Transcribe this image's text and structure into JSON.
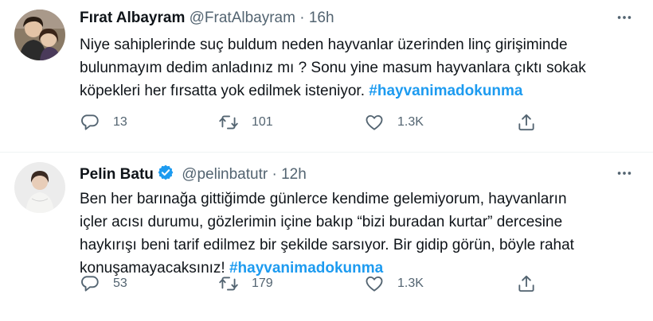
{
  "tweets": [
    {
      "name": "Fırat Albayram",
      "handle": "@FratAlbayram",
      "separator": "·",
      "time": "16h",
      "verified": false,
      "text_lines": [
        "Niye sahiplerinde suç buldum neden hayvanlar üzerinden  linç girişiminde",
        "bulunmayım dedim anladınız mı ?  Sonu yine masum hayvanlara çıktı sokak",
        "köpekleri her fırsatta yok edilmek isteniyor. "
      ],
      "hashtag": "#hayvanimadokunma",
      "replies": "13",
      "retweets": "101",
      "likes": "1.3K"
    },
    {
      "name": "Pelin Batu",
      "handle": "@pelinbatutr",
      "separator": "·",
      "time": "12h",
      "verified": true,
      "text_lines": [
        "Ben her barınağa gittiğimde günlerce kendime gelemiyorum, hayvanların",
        "içler acısı durumu, gözlerimin içine bakıp “bizi buradan kurtar” dercesine",
        "haykırışı beni tarif edilmez bir şekilde sarsıyor. Bir gidip görün, böyle rahat",
        "konuşamayacaksınız! "
      ],
      "hashtag": "#hayvanimadokunma",
      "replies": "53",
      "retweets": "179",
      "likes": "1.3K"
    }
  ],
  "colors": {
    "text": "#0f1419",
    "muted": "#536471",
    "accent": "#1d9bf0",
    "divider": "#eff3f4"
  },
  "icons": {
    "more": "more-icon",
    "reply": "reply-icon",
    "retweet": "retweet-icon",
    "like": "heart-icon",
    "share": "share-icon",
    "verified": "verified-badge-icon"
  }
}
